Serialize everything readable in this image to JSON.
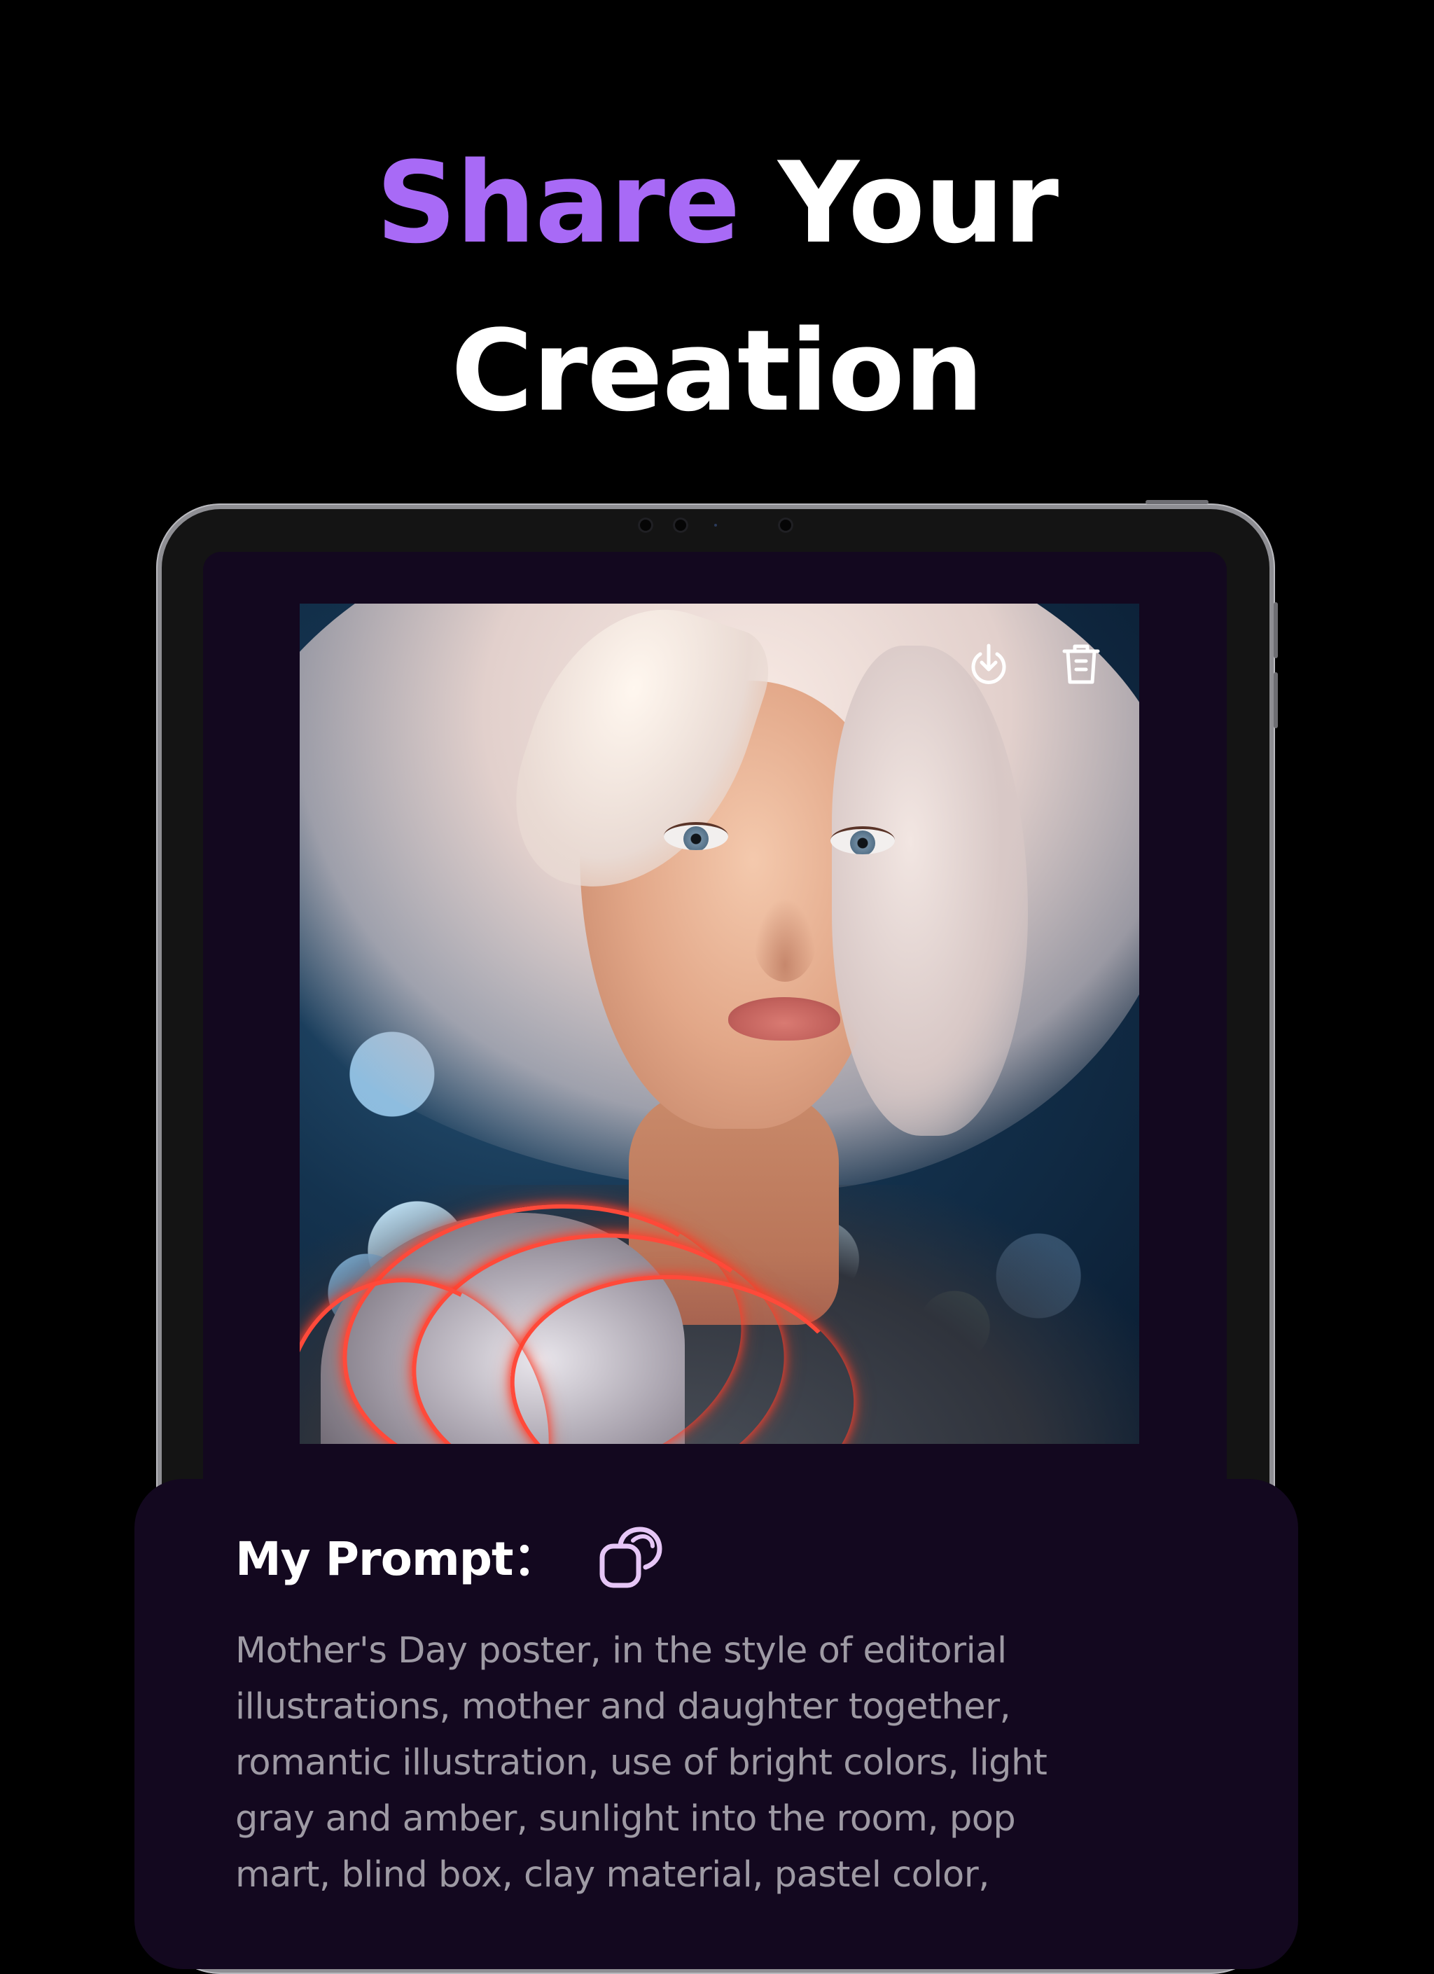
{
  "headline": {
    "accent_word": "Share",
    "rest_line1": " Your",
    "line2": "Creation",
    "accent_color": "#a86af6"
  },
  "image_actions": {
    "download_icon": "download-icon",
    "delete_icon": "trash-icon"
  },
  "prompt": {
    "title": "My Prompt：",
    "copy_icon": "copy-icon",
    "lines": [
      "Mother's Day poster, in the style of editorial",
      "illustrations, mother and daughter together,",
      "romantic illustration, use of bright colors, light",
      "gray and amber, sunlight into the room, pop",
      "mart, blind box, clay material, pastel color,"
    ]
  }
}
